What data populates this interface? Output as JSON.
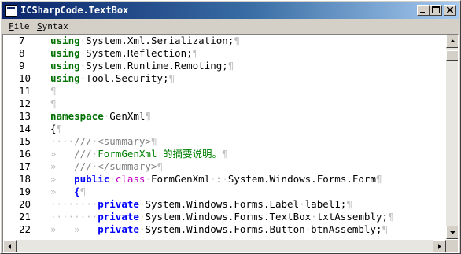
{
  "window": {
    "title": "ICSharpCode.TextBox"
  },
  "menu": {
    "items": [
      "File",
      "Syntax"
    ]
  },
  "editor": {
    "lines": [
      {
        "num": "7",
        "segments": [
          {
            "t": "using",
            "c": "kw"
          },
          {
            "t": "·",
            "c": "ws"
          },
          {
            "t": "System.Xml.Serialization;",
            "c": "pl"
          },
          {
            "t": "¶",
            "c": "ws"
          }
        ]
      },
      {
        "num": "8",
        "segments": [
          {
            "t": "using",
            "c": "kw"
          },
          {
            "t": "·",
            "c": "ws"
          },
          {
            "t": "System.Reflection;",
            "c": "pl"
          },
          {
            "t": "¶",
            "c": "ws"
          }
        ]
      },
      {
        "num": "9",
        "segments": [
          {
            "t": "using",
            "c": "kw"
          },
          {
            "t": "·",
            "c": "ws"
          },
          {
            "t": "System.Runtime.Remoting;",
            "c": "pl"
          },
          {
            "t": "¶",
            "c": "ws"
          }
        ]
      },
      {
        "num": "10",
        "segments": [
          {
            "t": "using",
            "c": "kw"
          },
          {
            "t": "·",
            "c": "ws"
          },
          {
            "t": "Tool.Security;",
            "c": "pl"
          },
          {
            "t": "¶",
            "c": "ws"
          }
        ]
      },
      {
        "num": "11",
        "segments": [
          {
            "t": "¶",
            "c": "ws"
          }
        ]
      },
      {
        "num": "12",
        "segments": [
          {
            "t": "¶",
            "c": "ws"
          }
        ]
      },
      {
        "num": "13",
        "segments": [
          {
            "t": "namespace",
            "c": "kw"
          },
          {
            "t": "·",
            "c": "ws"
          },
          {
            "t": "GenXml",
            "c": "pl"
          },
          {
            "t": "¶",
            "c": "ws"
          }
        ]
      },
      {
        "num": "14",
        "segments": [
          {
            "t": "{",
            "c": "pl"
          },
          {
            "t": "¶",
            "c": "ws"
          }
        ]
      },
      {
        "num": "15",
        "segments": [
          {
            "t": "····",
            "c": "ws"
          },
          {
            "t": "///",
            "c": "doc"
          },
          {
            "t": "·",
            "c": "ws"
          },
          {
            "t": "<summary>",
            "c": "tag"
          },
          {
            "t": "¶",
            "c": "ws"
          }
        ]
      },
      {
        "num": "16",
        "segments": [
          {
            "t": "»   ",
            "c": "ws"
          },
          {
            "t": "///",
            "c": "doc"
          },
          {
            "t": "·",
            "c": "ws"
          },
          {
            "t": "FormGenXml 的摘要说明。",
            "c": "cmt"
          },
          {
            "t": "¶",
            "c": "ws"
          }
        ]
      },
      {
        "num": "17",
        "segments": [
          {
            "t": "»   ",
            "c": "ws"
          },
          {
            "t": "///",
            "c": "doc"
          },
          {
            "t": "·",
            "c": "ws"
          },
          {
            "t": "</summary>",
            "c": "tag"
          },
          {
            "t": "¶",
            "c": "ws"
          }
        ]
      },
      {
        "num": "18",
        "segments": [
          {
            "t": "»   ",
            "c": "ws"
          },
          {
            "t": "public",
            "c": "kw2"
          },
          {
            "t": "·",
            "c": "ws"
          },
          {
            "t": "class",
            "c": "mod"
          },
          {
            "t": "·",
            "c": "ws"
          },
          {
            "t": "FormGenXml",
            "c": "pl"
          },
          {
            "t": "·",
            "c": "ws"
          },
          {
            "t": ":",
            "c": "pl"
          },
          {
            "t": "·",
            "c": "ws"
          },
          {
            "t": "System.Windows.Forms.Form",
            "c": "pl"
          },
          {
            "t": "¶",
            "c": "ws"
          }
        ]
      },
      {
        "num": "19",
        "segments": [
          {
            "t": "»   ",
            "c": "ws"
          },
          {
            "t": "{",
            "c": "kw2"
          },
          {
            "t": "¶",
            "c": "ws"
          }
        ]
      },
      {
        "num": "20",
        "segments": [
          {
            "t": "········",
            "c": "ws"
          },
          {
            "t": "private",
            "c": "kw2"
          },
          {
            "t": "·",
            "c": "ws"
          },
          {
            "t": "System.Windows.Forms.Label",
            "c": "pl"
          },
          {
            "t": "·",
            "c": "ws"
          },
          {
            "t": "label1;",
            "c": "pl"
          },
          {
            "t": "¶",
            "c": "ws"
          }
        ]
      },
      {
        "num": "21",
        "segments": [
          {
            "t": "········",
            "c": "ws"
          },
          {
            "t": "private",
            "c": "kw2"
          },
          {
            "t": "·",
            "c": "ws"
          },
          {
            "t": "System.Windows.Forms.TextBox",
            "c": "pl"
          },
          {
            "t": "·",
            "c": "ws"
          },
          {
            "t": "txtAssembly;",
            "c": "pl"
          },
          {
            "t": "¶",
            "c": "ws"
          }
        ]
      },
      {
        "num": "22",
        "segments": [
          {
            "t": "»   ",
            "c": "ws"
          },
          {
            "t": "»   ",
            "c": "ws"
          },
          {
            "t": "private",
            "c": "kw2"
          },
          {
            "t": "·",
            "c": "ws"
          },
          {
            "t": "System.Windows.Forms.Button",
            "c": "pl"
          },
          {
            "t": "·",
            "c": "ws"
          },
          {
            "t": "btnAssembly;",
            "c": "pl"
          },
          {
            "t": "¶",
            "c": "ws"
          }
        ]
      }
    ]
  },
  "icons": {
    "app": "app-icon",
    "minimize": "minimize-icon",
    "maximize": "maximize-icon",
    "close": "close-icon",
    "scroll_up": "arrow-up-icon",
    "scroll_down": "arrow-down-icon",
    "scroll_left": "arrow-left-icon",
    "scroll_right": "arrow-right-icon"
  }
}
